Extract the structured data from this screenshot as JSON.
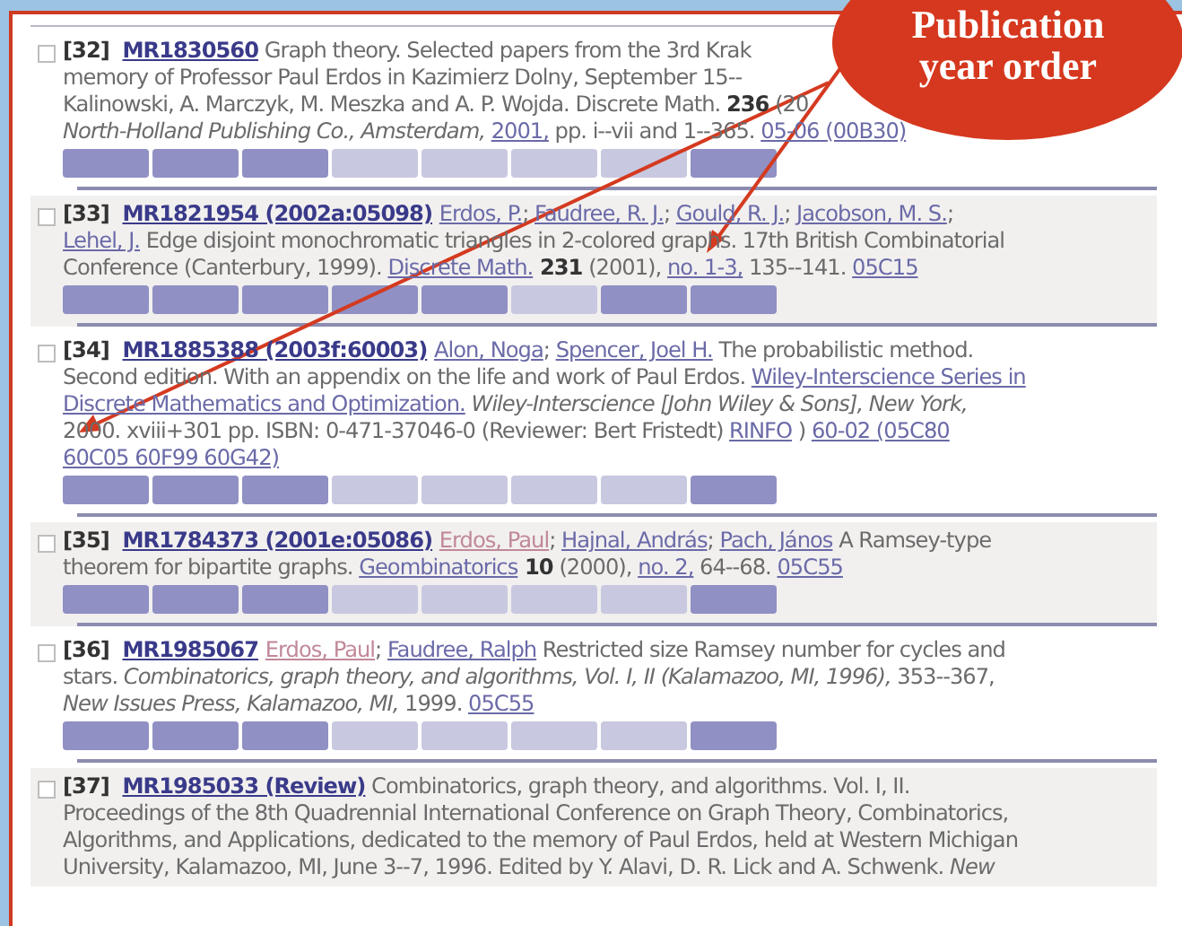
{
  "entries": [
    {
      "number": "[32]",
      "checked": false,
      "shaded": false,
      "lines": [
        [
          {
            "kind": "mr",
            "text": "MR1830560"
          },
          {
            "kind": "text",
            "text": " Graph theory. Selected papers from the 3rd Krak"
          }
        ],
        [
          {
            "kind": "text",
            "text": "memory of Professor Paul Erdos in Kazimierz Dolny, September 15--"
          }
        ],
        [
          {
            "kind": "text",
            "text": "Kalinowski, A. Marczyk, M. Meszka and A. P. Wojda. Discrete Math. "
          },
          {
            "kind": "bold",
            "text": "236"
          },
          {
            "kind": "text",
            "text": " (20"
          }
        ],
        [
          {
            "kind": "italic",
            "text": "North-Holland Publishing Co., Amsterdam, "
          },
          {
            "kind": "link",
            "text": "2001,"
          },
          {
            "kind": "text",
            "text": " pp. i--vii and 1--365. "
          },
          {
            "kind": "link",
            "text": "05-06 (00B30)"
          }
        ]
      ],
      "buttons": [
        {
          "disabled": false
        },
        {
          "disabled": false
        },
        {
          "disabled": false
        },
        {
          "disabled": true
        },
        {
          "disabled": true
        },
        {
          "disabled": true
        },
        {
          "disabled": true
        },
        {
          "disabled": false
        }
      ]
    },
    {
      "number": "[33]",
      "checked": false,
      "shaded": true,
      "lines": [
        [
          {
            "kind": "mr",
            "text": "MR1821954 (2002a:05098)"
          },
          {
            "kind": "link",
            "text": "Erdos, P.",
            "space_before": true
          },
          {
            "kind": "text",
            "text": "; "
          },
          {
            "kind": "link",
            "text": "Faudree, R. J."
          },
          {
            "kind": "text",
            "text": "; "
          },
          {
            "kind": "link",
            "text": "Gould, R. J."
          },
          {
            "kind": "text",
            "text": "; "
          },
          {
            "kind": "link",
            "text": "Jacobson, M. S."
          },
          {
            "kind": "text",
            "text": ";"
          }
        ],
        [
          {
            "kind": "link",
            "text": "Lehel, J."
          },
          {
            "kind": "text",
            "text": " Edge disjoint monochromatic triangles in 2-colored graphs. 17th British Combinatorial"
          }
        ],
        [
          {
            "kind": "text",
            "text": "Conference (Canterbury, 1999). "
          },
          {
            "kind": "link",
            "text": "Discrete Math."
          },
          {
            "kind": "bold",
            "text": "231",
            "space_before": true
          },
          {
            "kind": "text",
            "text": " (2001), "
          },
          {
            "kind": "link",
            "text": "no. 1-3,"
          },
          {
            "kind": "text",
            "text": " 135--141. "
          },
          {
            "kind": "link",
            "text": "05C15"
          }
        ]
      ],
      "buttons": [
        {
          "disabled": false
        },
        {
          "disabled": false
        },
        {
          "disabled": false
        },
        {
          "disabled": false
        },
        {
          "disabled": false
        },
        {
          "disabled": true
        },
        {
          "disabled": false
        },
        {
          "disabled": false
        }
      ]
    },
    {
      "number": "[34]",
      "checked": false,
      "shaded": false,
      "lines": [
        [
          {
            "kind": "mr",
            "text": "MR1885388 (2003f:60003)"
          },
          {
            "kind": "link",
            "text": "Alon, Noga",
            "space_before": true
          },
          {
            "kind": "text",
            "text": "; "
          },
          {
            "kind": "link",
            "text": "Spencer, Joel H."
          },
          {
            "kind": "text",
            "text": " The probabilistic method."
          }
        ],
        [
          {
            "kind": "text",
            "text": "Second edition. With an appendix on the life and work of Paul Erdos. "
          },
          {
            "kind": "link",
            "text": "Wiley-Interscience Series in"
          }
        ],
        [
          {
            "kind": "link",
            "text": "Discrete Mathematics and Optimization."
          },
          {
            "kind": "italic",
            "text": " Wiley-Interscience [John Wiley & Sons], New York,"
          }
        ],
        [
          {
            "kind": "text",
            "text": "2000. xviii+301 pp. ISBN: 0-471-37046-0 (Reviewer: Bert Fristedt) "
          },
          {
            "kind": "link",
            "text": "RINFO"
          },
          {
            "kind": "text",
            "text": " ) "
          },
          {
            "kind": "link",
            "text": "60-02 (05C80"
          }
        ],
        [
          {
            "kind": "link",
            "text": "60C05 60F99 60G42)"
          }
        ]
      ],
      "buttons": [
        {
          "disabled": false
        },
        {
          "disabled": false
        },
        {
          "disabled": false
        },
        {
          "disabled": true
        },
        {
          "disabled": true
        },
        {
          "disabled": true
        },
        {
          "disabled": true
        },
        {
          "disabled": false
        }
      ]
    },
    {
      "number": "[35]",
      "checked": false,
      "shaded": true,
      "lines": [
        [
          {
            "kind": "mr",
            "text": "MR1784373 (2001e:05086)"
          },
          {
            "kind": "visited",
            "text": "Erdos, Paul",
            "space_before": true
          },
          {
            "kind": "text",
            "text": "; "
          },
          {
            "kind": "link",
            "text": "Hajnal, András"
          },
          {
            "kind": "text",
            "text": "; "
          },
          {
            "kind": "link",
            "text": "Pach, János"
          },
          {
            "kind": "text",
            "text": " A Ramsey-type"
          }
        ],
        [
          {
            "kind": "text",
            "text": "theorem for bipartite graphs. "
          },
          {
            "kind": "link",
            "text": "Geombinatorics"
          },
          {
            "kind": "bold",
            "text": "10",
            "space_before": true
          },
          {
            "kind": "text",
            "text": " (2000), "
          },
          {
            "kind": "link",
            "text": "no. 2,"
          },
          {
            "kind": "text",
            "text": " 64--68. "
          },
          {
            "kind": "link",
            "text": "05C55"
          }
        ]
      ],
      "buttons": [
        {
          "disabled": false
        },
        {
          "disabled": false
        },
        {
          "disabled": false
        },
        {
          "disabled": true
        },
        {
          "disabled": true
        },
        {
          "disabled": true
        },
        {
          "disabled": true
        },
        {
          "disabled": false
        }
      ]
    },
    {
      "number": "[36]",
      "checked": false,
      "shaded": false,
      "lines": [
        [
          {
            "kind": "mr",
            "text": "MR1985067"
          },
          {
            "kind": "visited",
            "text": "Erdos, Paul",
            "space_before": true
          },
          {
            "kind": "text",
            "text": "; "
          },
          {
            "kind": "link",
            "text": "Faudree, Ralph"
          },
          {
            "kind": "text",
            "text": " Restricted size Ramsey number for cycles and"
          }
        ],
        [
          {
            "kind": "text",
            "text": "stars. "
          },
          {
            "kind": "italic",
            "text": "Combinatorics, graph theory, and algorithms, Vol. I, II (Kalamazoo, MI, 1996),"
          },
          {
            "kind": "text",
            "text": " 353--367,"
          }
        ],
        [
          {
            "kind": "italic",
            "text": "New Issues Press, Kalamazoo, MI,"
          },
          {
            "kind": "text",
            "text": " 1999. "
          },
          {
            "kind": "link",
            "text": "05C55"
          }
        ]
      ],
      "buttons": [
        {
          "disabled": false
        },
        {
          "disabled": false
        },
        {
          "disabled": false
        },
        {
          "disabled": true
        },
        {
          "disabled": true
        },
        {
          "disabled": true
        },
        {
          "disabled": true
        },
        {
          "disabled": false
        }
      ]
    },
    {
      "number": "[37]",
      "checked": false,
      "shaded": true,
      "lines": [
        [
          {
            "kind": "mr",
            "text": "MR1985033 (Review)"
          },
          {
            "kind": "text",
            "text": " Combinatorics, graph theory, and algorithms. Vol. I, II."
          }
        ],
        [
          {
            "kind": "text",
            "text": "Proceedings of the 8th Quadrennial International Conference on Graph Theory, Combinatorics,"
          }
        ],
        [
          {
            "kind": "text",
            "text": "Algorithms, and Applications, dedicated to the memory of Paul Erdos, held at Western Michigan"
          }
        ],
        [
          {
            "kind": "text",
            "text": "University, Kalamazoo, MI, June 3--7, 1996. Edited by Y. Alavi, D. R. Lick and A. Schwenk. "
          },
          {
            "kind": "italic",
            "text": "New"
          }
        ]
      ]
    }
  ],
  "callout": {
    "lines": [
      "Publication",
      "year order"
    ]
  }
}
